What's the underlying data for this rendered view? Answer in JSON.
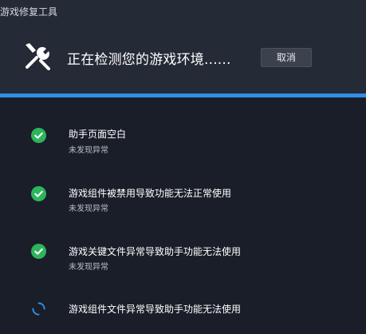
{
  "window": {
    "title": "游戏修复工具"
  },
  "header": {
    "status_text": "正在检测您的游戏环境......",
    "cancel_label": "取消",
    "icon": "wrench-icon"
  },
  "progress": {
    "fraction": 1.0
  },
  "items": [
    {
      "title": "助手页面空白",
      "result": "未发现异常",
      "state": "ok"
    },
    {
      "title": "游戏组件被禁用导致功能无法正常使用",
      "result": "未发现异常",
      "state": "ok"
    },
    {
      "title": "游戏关键文件异常导致助手功能无法使用",
      "result": "未发现异常",
      "state": "ok"
    },
    {
      "title": "游戏组件文件异常导致助手功能无法使用",
      "result": "",
      "state": "loading"
    }
  ],
  "colors": {
    "accent": "#2f8fe5",
    "ok": "#2db55d",
    "background": "#1a1e29",
    "header": "#242a36"
  }
}
